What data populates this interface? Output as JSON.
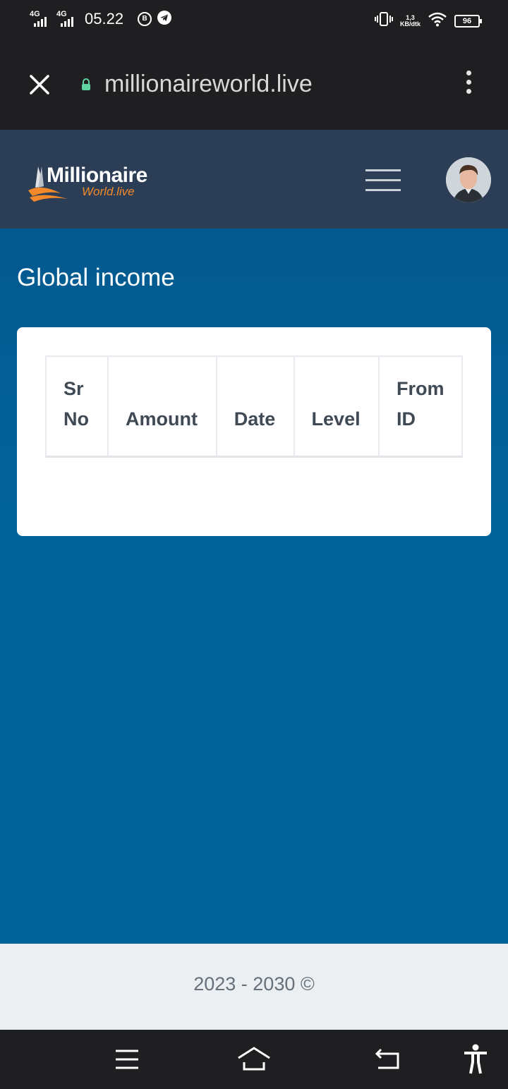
{
  "status_bar": {
    "signal1_label": "4G",
    "signal2_label": "4G",
    "time": "05.22",
    "icon_b_label": "B",
    "net_speed_value": "1,3",
    "net_speed_unit": "KB/dtk",
    "battery": "96"
  },
  "browser": {
    "url": "millionaireworld.live"
  },
  "header": {
    "logo_main": "Millionaire",
    "logo_sub": "World.live"
  },
  "page": {
    "title": "Global income"
  },
  "table": {
    "columns": [
      "Sr No",
      "Amount",
      "Date",
      "Level",
      "From ID"
    ]
  },
  "footer": {
    "text": "2023 - 2030 ©"
  }
}
